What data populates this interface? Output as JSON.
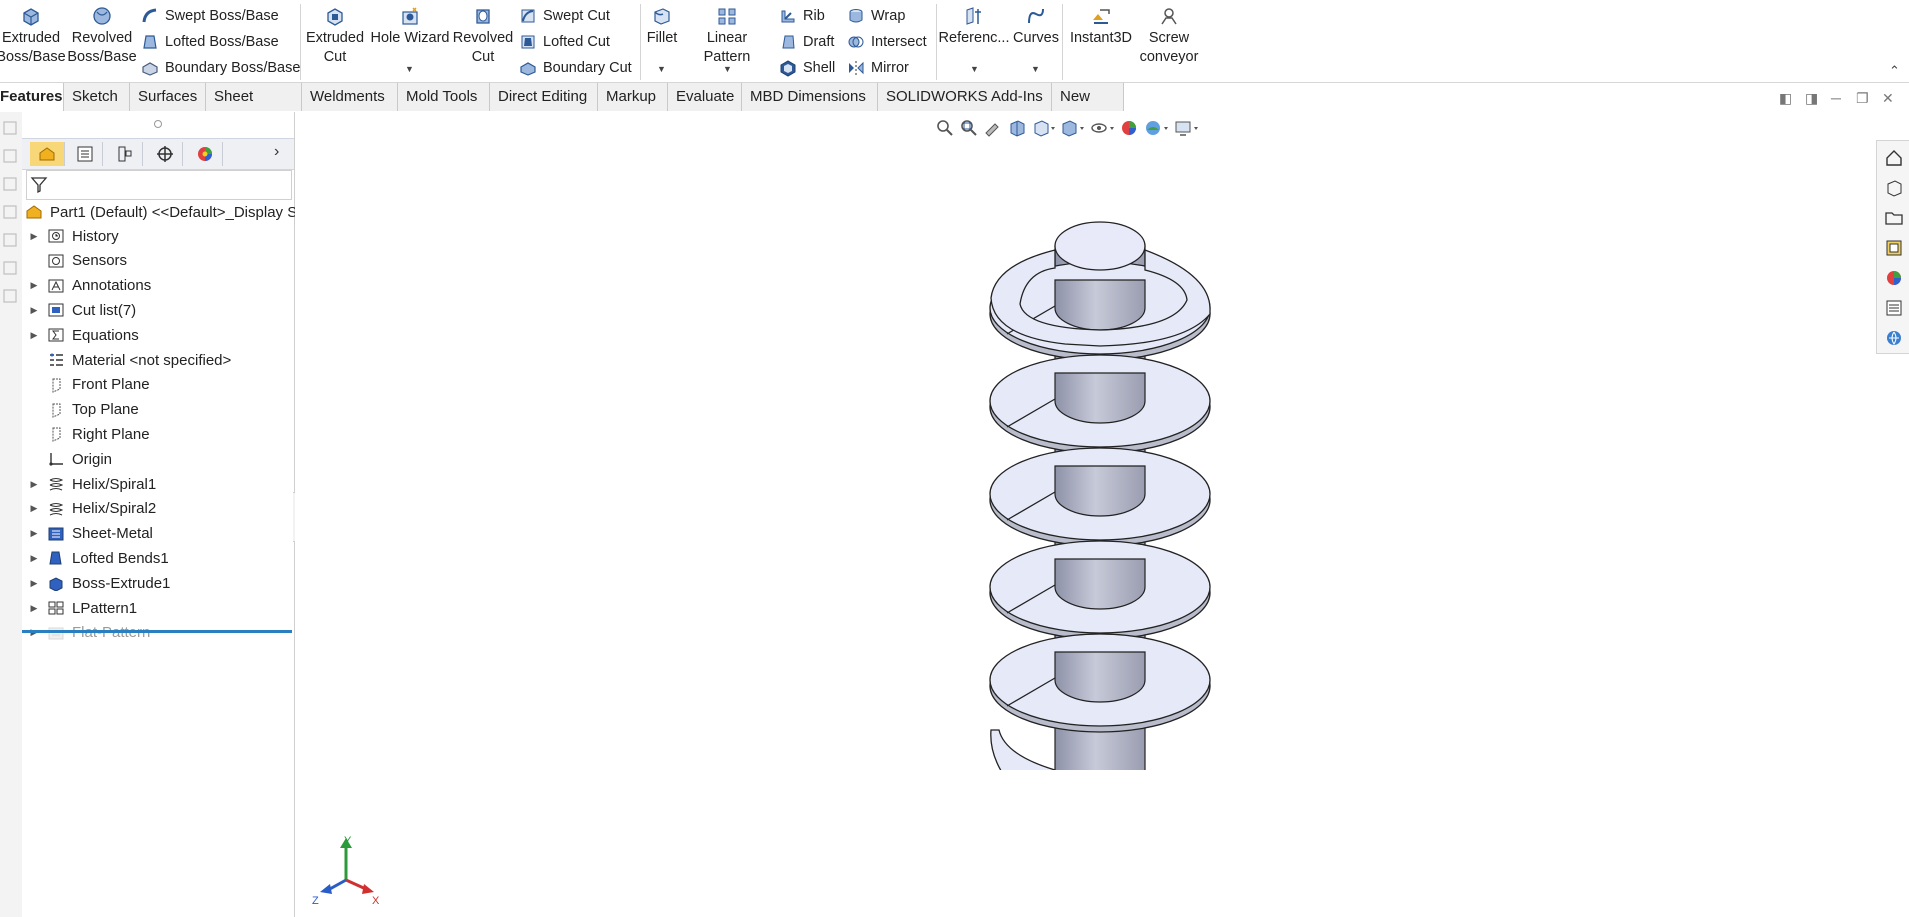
{
  "ribbon": {
    "extruded_boss": [
      "Extruded",
      "Boss/Base"
    ],
    "revolved_boss": [
      "Revolved",
      "Boss/Base"
    ],
    "swept_boss": "Swept Boss/Base",
    "lofted_boss": "Lofted Boss/Base",
    "boundary_boss": "Boundary Boss/Base",
    "extruded_cut": [
      "Extruded",
      "Cut"
    ],
    "hole_wizard": "Hole Wizard",
    "revolved_cut": [
      "Revolved",
      "Cut"
    ],
    "swept_cut": "Swept Cut",
    "lofted_cut": "Lofted Cut",
    "boundary_cut": "Boundary Cut",
    "fillet": "Fillet",
    "linear_pattern": "Linear Pattern",
    "rib": "Rib",
    "draft": "Draft",
    "shell": "Shell",
    "wrap": "Wrap",
    "intersect": "Intersect",
    "mirror": "Mirror",
    "reference": "Referenc...",
    "curves": "Curves",
    "instant3d": "Instant3D",
    "screw_conveyor": [
      "Screw",
      "conveyor"
    ]
  },
  "tabs": [
    "Features",
    "Sketch",
    "Surfaces",
    "Sheet Metal",
    "Weldments",
    "Mold Tools",
    "Direct Editing",
    "Markup",
    "Evaluate",
    "MBD Dimensions",
    "SOLIDWORKS Add-Ins",
    "New Tab"
  ],
  "active_tab": "Features",
  "tree": {
    "root": "Part1 (Default) <<Default>_Display S",
    "items": [
      {
        "label": "History",
        "icon": "history-icon",
        "expandable": true
      },
      {
        "label": "Sensors",
        "icon": "sensors-icon",
        "expandable": false
      },
      {
        "label": "Annotations",
        "icon": "annotations-icon",
        "expandable": true
      },
      {
        "label": "Cut list(7)",
        "icon": "cut-list-icon",
        "expandable": true
      },
      {
        "label": "Equations",
        "icon": "equations-icon",
        "expandable": true
      },
      {
        "label": "Material <not specified>",
        "icon": "material-icon",
        "expandable": false
      },
      {
        "label": "Front Plane",
        "icon": "plane-icon",
        "expandable": false
      },
      {
        "label": "Top Plane",
        "icon": "plane-icon",
        "expandable": false
      },
      {
        "label": "Right Plane",
        "icon": "plane-icon",
        "expandable": false
      },
      {
        "label": "Origin",
        "icon": "origin-icon",
        "expandable": false
      },
      {
        "label": "Helix/Spiral1",
        "icon": "helix-icon",
        "expandable": true
      },
      {
        "label": "Helix/Spiral2",
        "icon": "helix-icon",
        "expandable": true
      },
      {
        "label": "Sheet-Metal",
        "icon": "sheet-metal-icon",
        "expandable": true
      },
      {
        "label": "Lofted Bends1",
        "icon": "lofted-bends-icon",
        "expandable": true
      },
      {
        "label": "Boss-Extrude1",
        "icon": "boss-extrude-icon",
        "expandable": true
      },
      {
        "label": "LPattern1",
        "icon": "linear-pattern-icon",
        "expandable": true
      },
      {
        "label": "Flat-Pattern",
        "icon": "flat-pattern-icon",
        "expandable": true,
        "suppressed": true
      }
    ]
  },
  "triad": {
    "x": "X",
    "y": "Y",
    "z": "Z"
  },
  "colors": {
    "accent": "#2a7fc0",
    "model_face": "#e6e9f8",
    "model_shade": "#b9bccb",
    "triad_x": "#d03030",
    "triad_y": "#2a9a3a",
    "triad_z": "#2a5cc8"
  }
}
